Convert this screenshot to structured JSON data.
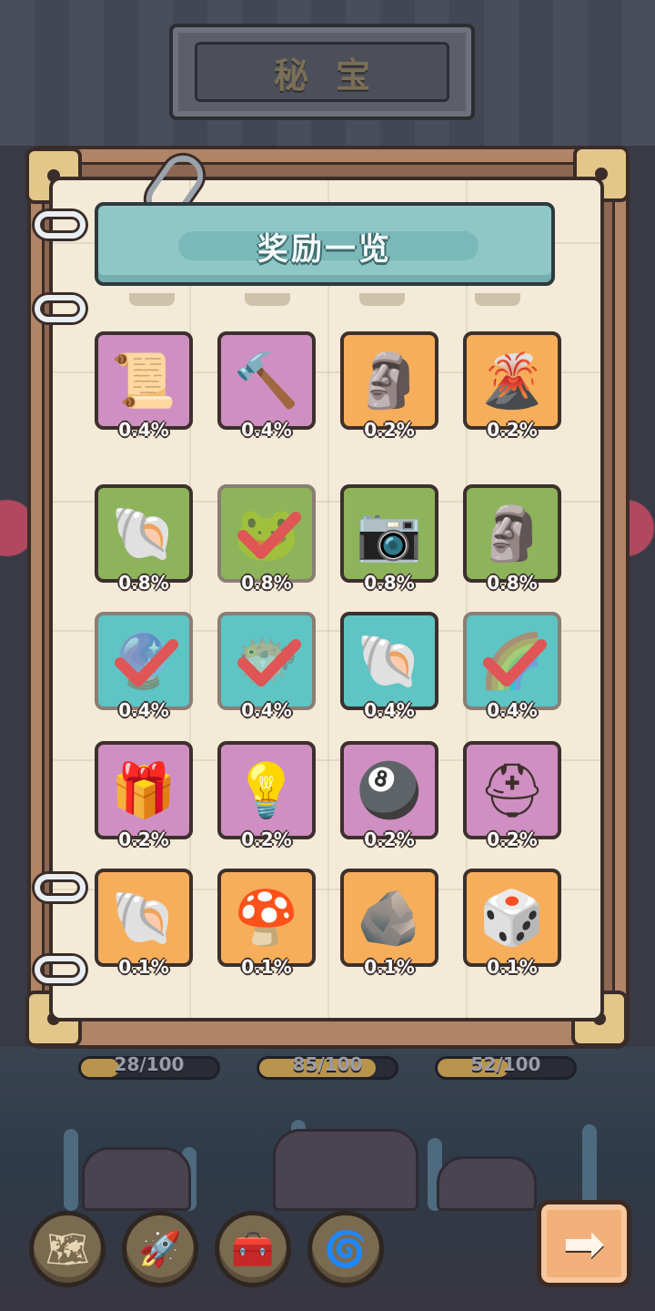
{
  "header": {
    "title": "秘宝"
  },
  "panel": {
    "title": "奖励一览"
  },
  "rewards": [
    {
      "name": "map-scroll-icon",
      "color": "#cf8fc3",
      "percent": "0.4%",
      "collected": false,
      "glyph": "📜"
    },
    {
      "name": "hammer-icon",
      "color": "#cf8fc3",
      "percent": "0.4%",
      "collected": false,
      "glyph": "🔨"
    },
    {
      "name": "tribal-mask-icon",
      "color": "#f6ae5a",
      "percent": "0.2%",
      "collected": false,
      "glyph": "🗿"
    },
    {
      "name": "volcano-icon",
      "color": "#f6ae5a",
      "percent": "0.2%",
      "collected": false,
      "glyph": "🌋"
    },
    {
      "name": "eyeball-shell-icon",
      "color": "#8db35b",
      "percent": "0.8%",
      "collected": false,
      "glyph": "🐚"
    },
    {
      "name": "frog-icon",
      "color": "#8db35b",
      "percent": "0.8%",
      "collected": true,
      "glyph": "🐸"
    },
    {
      "name": "camera-icon",
      "color": "#8db35b",
      "percent": "0.8%",
      "collected": false,
      "glyph": "📷"
    },
    {
      "name": "stone-head-icon",
      "color": "#8db35b",
      "percent": "0.8%",
      "collected": false,
      "glyph": "🗿"
    },
    {
      "name": "crystal-ball-icon",
      "color": "#5fc4c4",
      "percent": "0.4%",
      "collected": true,
      "glyph": "🔮"
    },
    {
      "name": "pufferfish-icon",
      "color": "#5fc4c4",
      "percent": "0.4%",
      "collected": true,
      "glyph": "🐡"
    },
    {
      "name": "ammonite-icon",
      "color": "#5fc4c4",
      "percent": "0.4%",
      "collected": false,
      "glyph": "🐚"
    },
    {
      "name": "rainbow-shell-icon",
      "color": "#5fc4c4",
      "percent": "0.4%",
      "collected": true,
      "glyph": "🌈"
    },
    {
      "name": "gift-box-icon",
      "color": "#cf8fc3",
      "percent": "0.2%",
      "collected": false,
      "glyph": "🎁"
    },
    {
      "name": "light-bulb-icon",
      "color": "#cf8fc3",
      "percent": "0.2%",
      "collected": false,
      "glyph": "💡"
    },
    {
      "name": "bowling-ball-icon",
      "color": "#cf8fc3",
      "percent": "0.2%",
      "collected": false,
      "glyph": "🎱"
    },
    {
      "name": "helmet-icon",
      "color": "#cf8fc3",
      "percent": "0.2%",
      "collected": false,
      "glyph": "⛑"
    },
    {
      "name": "conch-shell-icon",
      "color": "#f6ae5a",
      "percent": "0.1%",
      "collected": false,
      "glyph": "🐚"
    },
    {
      "name": "mushroom-icon",
      "color": "#f6ae5a",
      "percent": "0.1%",
      "collected": false,
      "glyph": "🍄"
    },
    {
      "name": "stone-golem-icon",
      "color": "#f6ae5a",
      "percent": "0.1%",
      "collected": false,
      "glyph": "🪨"
    },
    {
      "name": "dice-icon",
      "color": "#f6ae5a",
      "percent": "0.1%",
      "collected": false,
      "glyph": "🎲"
    }
  ],
  "progress": [
    {
      "label": "28/100",
      "value": 0.28
    },
    {
      "label": "85/100",
      "value": 0.85
    },
    {
      "label": "52/100",
      "value": 0.52
    }
  ],
  "toolbar": [
    {
      "name": "map-button",
      "icon": "map-icon",
      "glyph": "🗺"
    },
    {
      "name": "rocket-button",
      "icon": "rocket-icon",
      "glyph": "🚀"
    },
    {
      "name": "treasure-chest-button",
      "icon": "treasure-chest-icon",
      "glyph": "🧰"
    },
    {
      "name": "swirl-shell-button",
      "icon": "swirl-shell-icon",
      "glyph": "🌀"
    }
  ],
  "next": {
    "icon": "arrow-right-icon",
    "glyph": "➡"
  }
}
